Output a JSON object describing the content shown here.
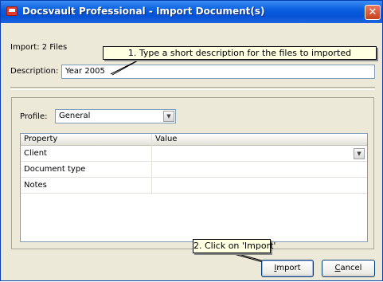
{
  "window": {
    "title": "Docsvault Professional - Import Document(s)",
    "close_glyph": "✕"
  },
  "import": {
    "count_label": "Import: 2 Files"
  },
  "description": {
    "label": "Description:",
    "value": "Year 2005"
  },
  "callouts": {
    "step1": "1. Type a short description for the files to imported",
    "step2": "2. Click on 'Import'"
  },
  "profile": {
    "label": "Profile:",
    "selected": "General"
  },
  "properties": {
    "columns": [
      "Property",
      "Value"
    ],
    "rows": [
      {
        "property": "Client",
        "value": ""
      },
      {
        "property": "Document type",
        "value": ""
      },
      {
        "property": "Notes",
        "value": ""
      }
    ]
  },
  "buttons": {
    "import_access": "I",
    "import_rest": "mport",
    "cancel_access": "C",
    "cancel_rest": "ancel"
  },
  "icons": {
    "app": "docsvault-app-icon",
    "close": "close-icon",
    "dropdown": "chevron-down-icon"
  },
  "colors": {
    "titlebar": "#0a5fe0",
    "dialog_bg": "#ece9d8",
    "callout_bg": "#ffffe1",
    "close_button": "#d9573a"
  }
}
